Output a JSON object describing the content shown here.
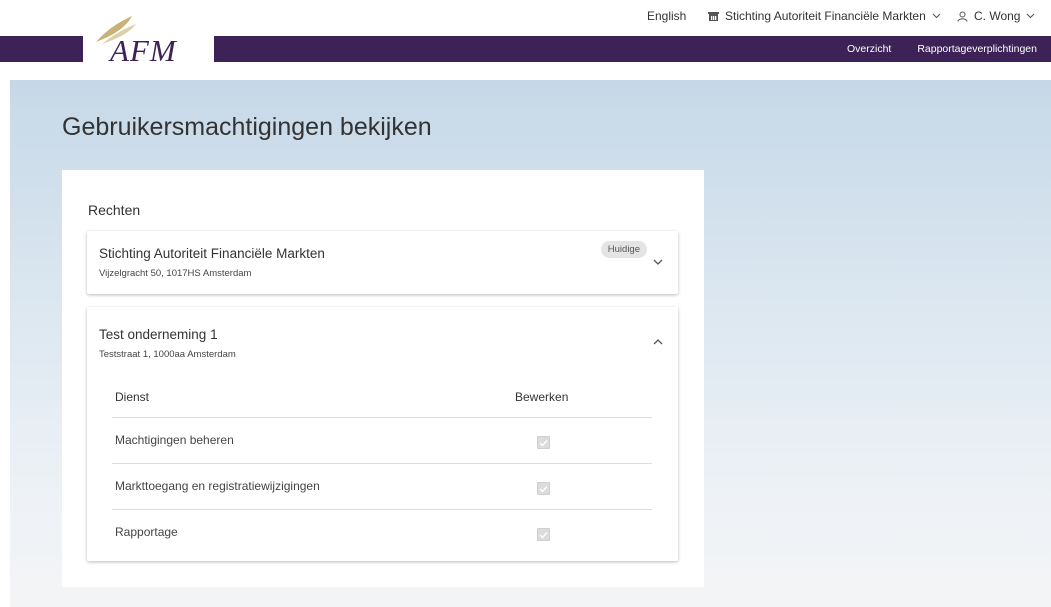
{
  "header": {
    "language": "English",
    "organization": "Stichting Autoriteit Financiële Markten",
    "user": "C. Wong",
    "logo_text": "AFM",
    "nav": [
      {
        "label": "Overzicht"
      },
      {
        "label": "Rapportageverplichtingen"
      }
    ]
  },
  "page": {
    "title": "Gebruikersmachtigingen bekijken",
    "section_title": "Rechten"
  },
  "organizations": [
    {
      "name": "Stichting Autoriteit Financiële Markten",
      "address": "Vijzelgracht 50, 1017HS Amsterdam",
      "badge": "Huidige",
      "expanded": false
    },
    {
      "name": "Test onderneming 1",
      "address": "Teststraat 1, 1000aa Amsterdam",
      "expanded": true,
      "table": {
        "columns": [
          "Dienst",
          "Bewerken"
        ],
        "rows": [
          {
            "service": "Machtigingen beheren",
            "edit": true
          },
          {
            "service": "Markttoegang en registratiewijzigingen",
            "edit": true
          },
          {
            "service": "Rapportage",
            "edit": true
          }
        ]
      }
    }
  ],
  "colors": {
    "brand_purple": "#3c2257",
    "logo_gold": "#c8b27a"
  }
}
